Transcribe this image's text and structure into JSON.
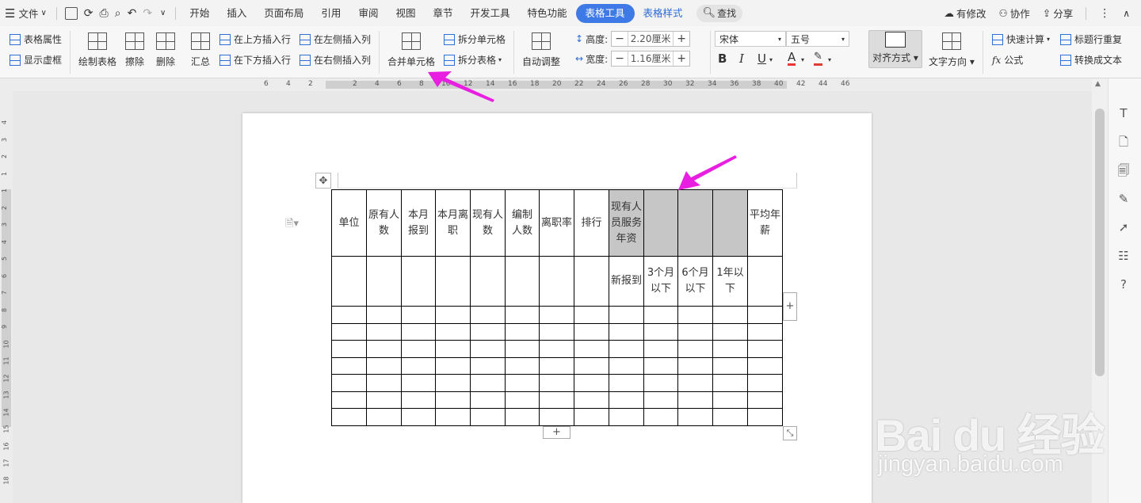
{
  "menubar": {
    "file": "文件",
    "tabs": [
      {
        "label": "开始",
        "state": "normal"
      },
      {
        "label": "插入",
        "state": "normal"
      },
      {
        "label": "页面布局",
        "state": "normal"
      },
      {
        "label": "引用",
        "state": "normal"
      },
      {
        "label": "审阅",
        "state": "normal"
      },
      {
        "label": "视图",
        "state": "normal"
      },
      {
        "label": "章节",
        "state": "normal"
      },
      {
        "label": "开发工具",
        "state": "normal"
      },
      {
        "label": "特色功能",
        "state": "normal"
      },
      {
        "label": "表格工具",
        "state": "active"
      },
      {
        "label": "表格样式",
        "state": "accent"
      }
    ],
    "search": "查找",
    "right": {
      "modified": "有修改",
      "collab": "协作",
      "share": "分享"
    }
  },
  "ribbon": {
    "table_props": "表格属性",
    "show_gridlines": "显示虚框",
    "draw_table": "绘制表格",
    "eraser": "擦除",
    "delete": "删除",
    "summary": "汇总",
    "insert_above": "在上方插入行",
    "insert_below": "在下方插入行",
    "insert_left": "在左侧插入列",
    "insert_right": "在右侧插入列",
    "merge_cells": "合并单元格",
    "split_cells": "拆分单元格",
    "split_table": "拆分表格",
    "auto_fit": "自动调整",
    "height_label": "高度:",
    "height_value": "2.20厘米",
    "width_label": "宽度:",
    "width_value": "1.16厘米",
    "font_name": "宋体",
    "font_size": "五号",
    "bold": "B",
    "italic": "I",
    "underline": "U",
    "font_color": "A",
    "alignment": "对齐方式",
    "text_direction": "文字方向",
    "quick_calc": "快速计算",
    "formula": "公式",
    "repeat_header": "标题行重复",
    "convert_text": "转换成文本"
  },
  "ruler": {
    "h_ticks": [
      "6",
      "4",
      "2",
      "2",
      "4",
      "6",
      "8",
      "10",
      "12",
      "14",
      "16",
      "18",
      "20",
      "22",
      "24",
      "26",
      "28",
      "30",
      "32",
      "34",
      "36",
      "38",
      "40",
      "42",
      "44",
      "46"
    ],
    "v_ticks": [
      "4",
      "3",
      "2",
      "1",
      "1",
      "2",
      "3",
      "4",
      "5",
      "6",
      "7",
      "8",
      "9",
      "10",
      "11",
      "12",
      "13",
      "14",
      "15",
      "16",
      "17",
      "18"
    ]
  },
  "table": {
    "header_row": [
      "单位",
      "原有人数",
      "本月报到",
      "本月离职",
      "现有人数",
      "编制人数",
      "离职率",
      "排行",
      "现有人员服务年资",
      "",
      "",
      "",
      "平均年薪"
    ],
    "sub_row": [
      "",
      "",
      "",
      "",
      "",
      "",
      "",
      "",
      "新报到",
      "3个月以下",
      "6个月以下",
      "1年以下",
      ""
    ],
    "empty_rows": 7,
    "cols": 13
  },
  "watermark": {
    "logo": "Bai du 经验",
    "url": "jingyan.baidu.com"
  },
  "colors": {
    "accent": "#3d7ae5",
    "arrow": "#e81ee0",
    "selected_cell": "#c6c6c6"
  }
}
